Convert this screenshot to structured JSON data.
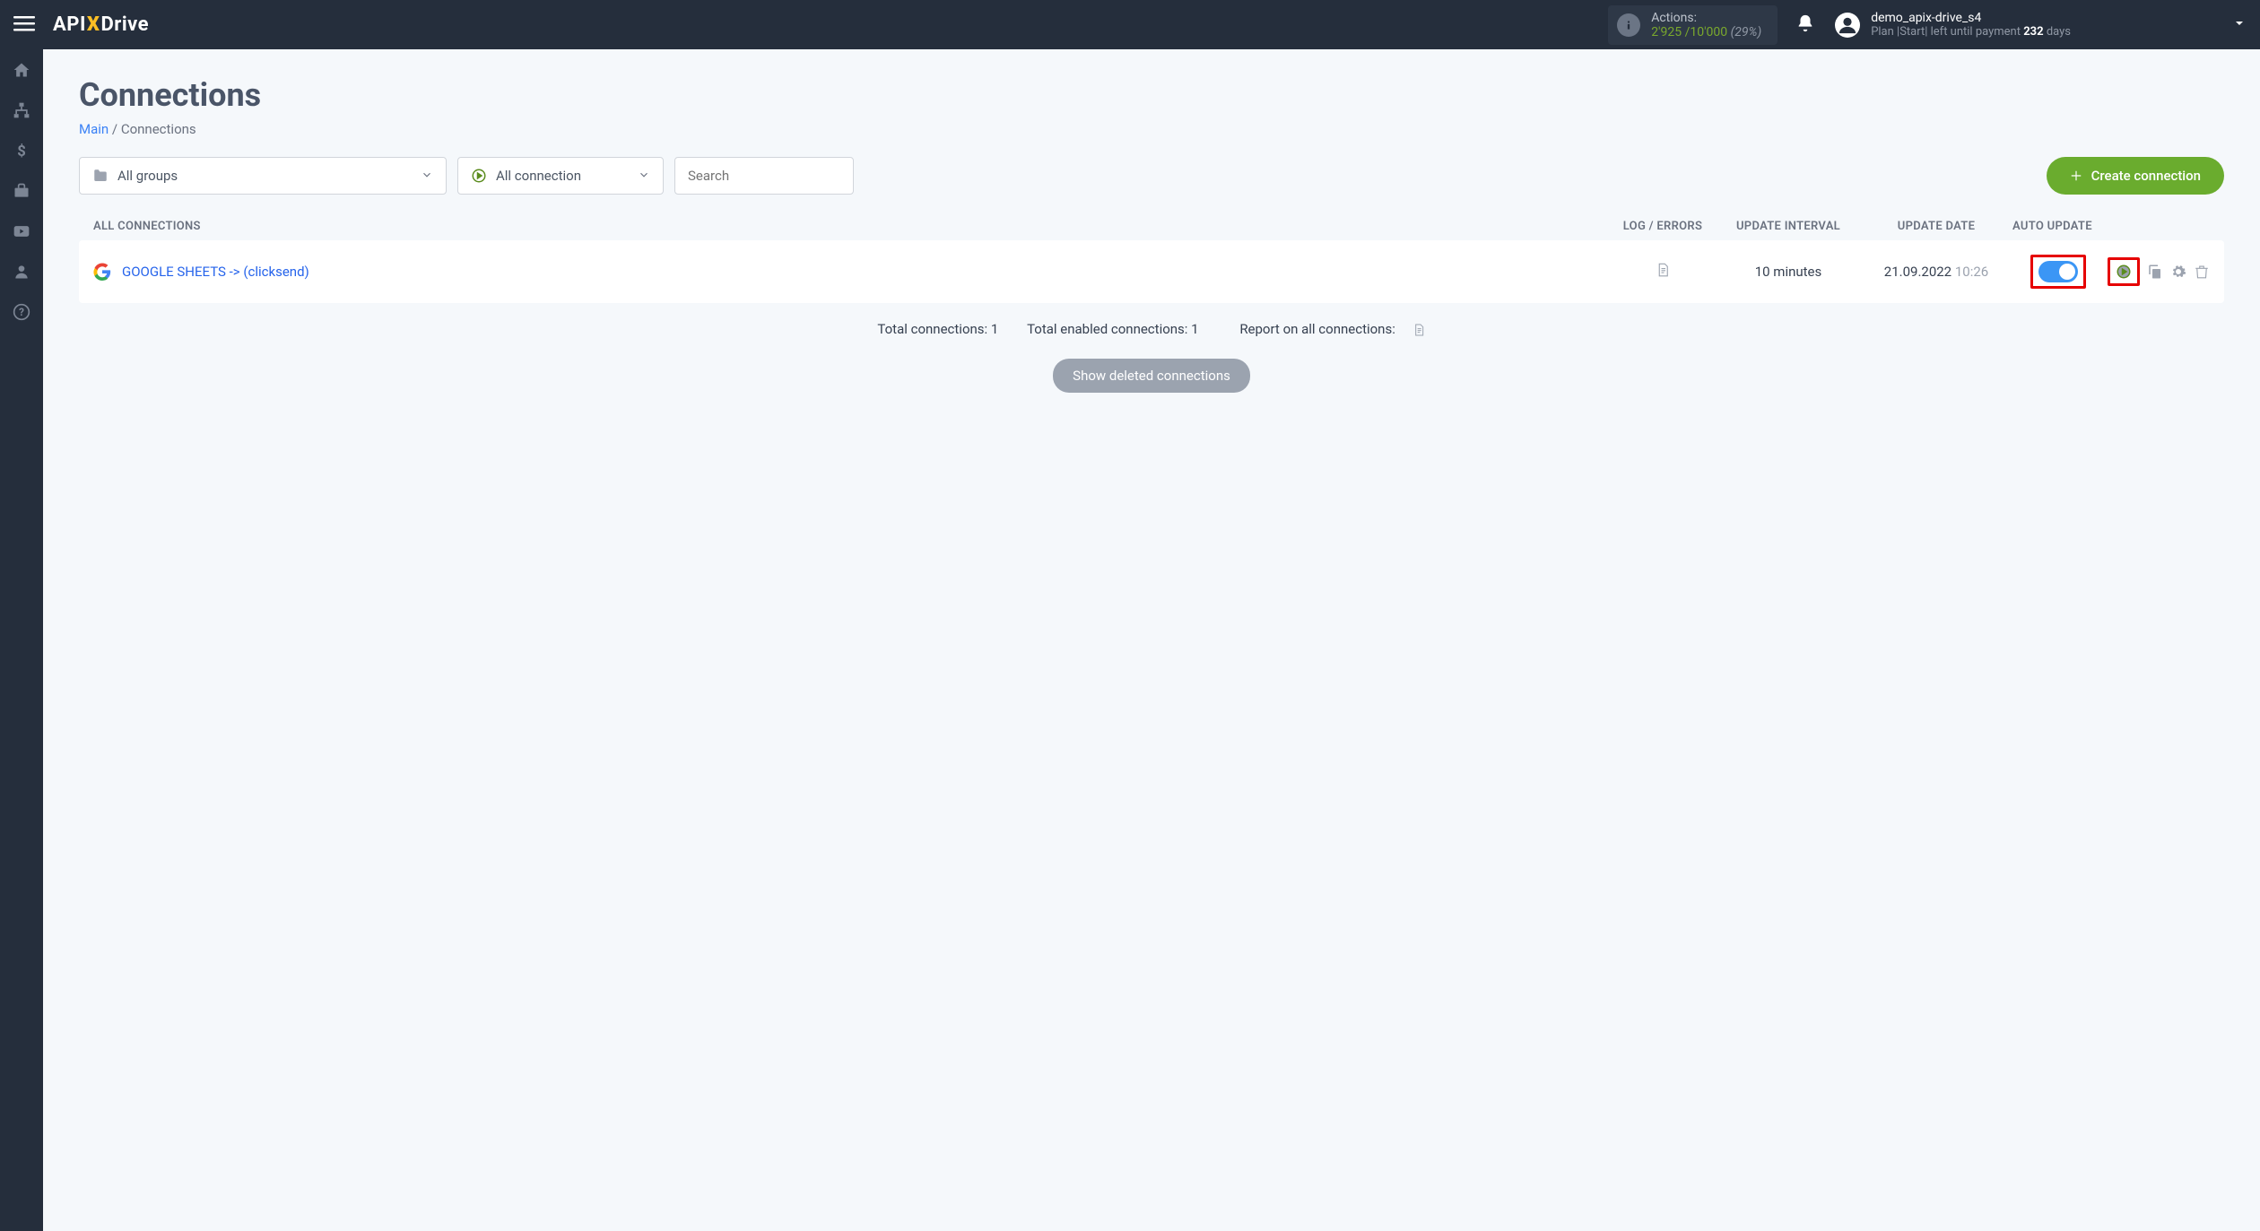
{
  "header": {
    "logo": {
      "part1": "API",
      "x": "X",
      "part2": "Drive"
    },
    "actions": {
      "label": "Actions:",
      "current": "2'925",
      "separator": " /",
      "total": "10'000",
      "pct": " (29%)"
    },
    "user": {
      "name": "demo_apix-drive_s4",
      "plan_prefix": "Plan |Start| left until payment ",
      "days": "232",
      "days_suffix": " days"
    }
  },
  "page": {
    "title": "Connections",
    "breadcrumb_main": "Main",
    "breadcrumb_sep": " / ",
    "breadcrumb_current": "Connections"
  },
  "filters": {
    "groups": "All groups",
    "connection": "All connection",
    "search_placeholder": "Search",
    "create_label": "Create connection"
  },
  "table": {
    "headers": {
      "all": "ALL CONNECTIONS",
      "log": "LOG / ERRORS",
      "interval": "UPDATE INTERVAL",
      "date": "UPDATE DATE",
      "auto": "AUTO UPDATE"
    },
    "rows": [
      {
        "name": "GOOGLE SHEETS -> (clicksend)",
        "interval": "10 minutes",
        "date": "21.09.2022",
        "time": "10:26"
      }
    ]
  },
  "summary": {
    "total": "Total connections: 1",
    "enabled": "Total enabled connections: 1",
    "report": "Report on all connections:"
  },
  "buttons": {
    "show_deleted": "Show deleted connections"
  }
}
